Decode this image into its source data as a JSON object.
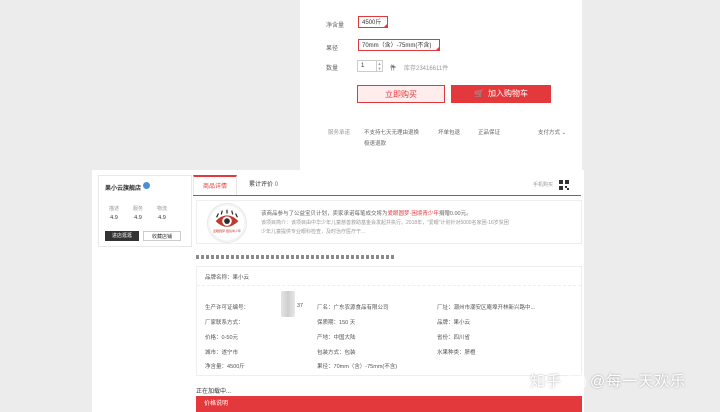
{
  "buy_panel": {
    "weight_label": "净含量",
    "weight_value": "4500斤",
    "spec_label": "果径",
    "spec_value": "70mm（含）-75mm(不含)",
    "qty_label": "数量",
    "qty_value": "1",
    "qty_unit": "件",
    "stock": "库存23416611件",
    "buy_now": "立即购买",
    "add_cart": "加入购物车",
    "service_label": "服务承诺",
    "service_items": [
      "不支持七天无理由退换",
      "坏单包退",
      "正品保证"
    ],
    "service_item_extra": "极速退款",
    "payment": "支付方式"
  },
  "shop": {
    "name": "果小云旗舰店",
    "ratings": [
      {
        "label": "描述",
        "score": "4.9"
      },
      {
        "label": "服务",
        "score": "4.9"
      },
      {
        "label": "物流",
        "score": "4.9"
      }
    ],
    "enter_button": "进店逛逛",
    "fav_button": "收藏店铺"
  },
  "tabs": {
    "detail": "商品详情",
    "reviews": "累计评价",
    "reviews_count": "0",
    "mobile": "手机购买"
  },
  "charity": {
    "line1_a": "该商品参与了公益宝贝计划，卖家承诺每笔成交将为",
    "line1_b": "爱眼圆梦·困境青少年",
    "line1_c": "捐赠0.00元。",
    "line2": "该项目简介：该项目由中华少年儿童慈善救助基金会发起并执行。2018年，“爱眼”计划针对5000名家困·16岁贫困",
    "line3": "少年儿童提供专业眼科检查，及时治疗医疗干...",
    "logo_caption": "爱眼圆梦·困境青少年"
  },
  "specs": {
    "brand_label": "品牌名称：",
    "brand_value": "果小云",
    "fields": [
      {
        "label": "生产许可证编号：",
        "value": "37"
      },
      {
        "label": "厂名：",
        "value": "广东农源食品有限公司"
      },
      {
        "label": "厂址：",
        "value": "潮州市潮安区庵埠开林新兴路中..."
      },
      {
        "label": "厂家联系方式：",
        "value": ""
      },
      {
        "label": "保质期：",
        "value": "150 天"
      },
      {
        "label": "品牌：",
        "value": "果小云"
      },
      {
        "label": "价格：",
        "value": "0-50元"
      },
      {
        "label": "产地：",
        "value": "中国大陆"
      },
      {
        "label": "省份：",
        "value": "四川省"
      },
      {
        "label": "城市：",
        "value": "遂宁市"
      },
      {
        "label": "包装方式：",
        "value": "包装"
      },
      {
        "label": "水果种类：",
        "value": "脐橙"
      },
      {
        "label": "净含量：",
        "value": "4500斤"
      },
      {
        "label": "果径：",
        "value": "70mm（含）-75mm(不含)"
      }
    ]
  },
  "loading": "正在加载中...",
  "price_bar": "价格说明",
  "watermark": {
    "left": "知乎",
    "right": "@每一天欢乐"
  }
}
